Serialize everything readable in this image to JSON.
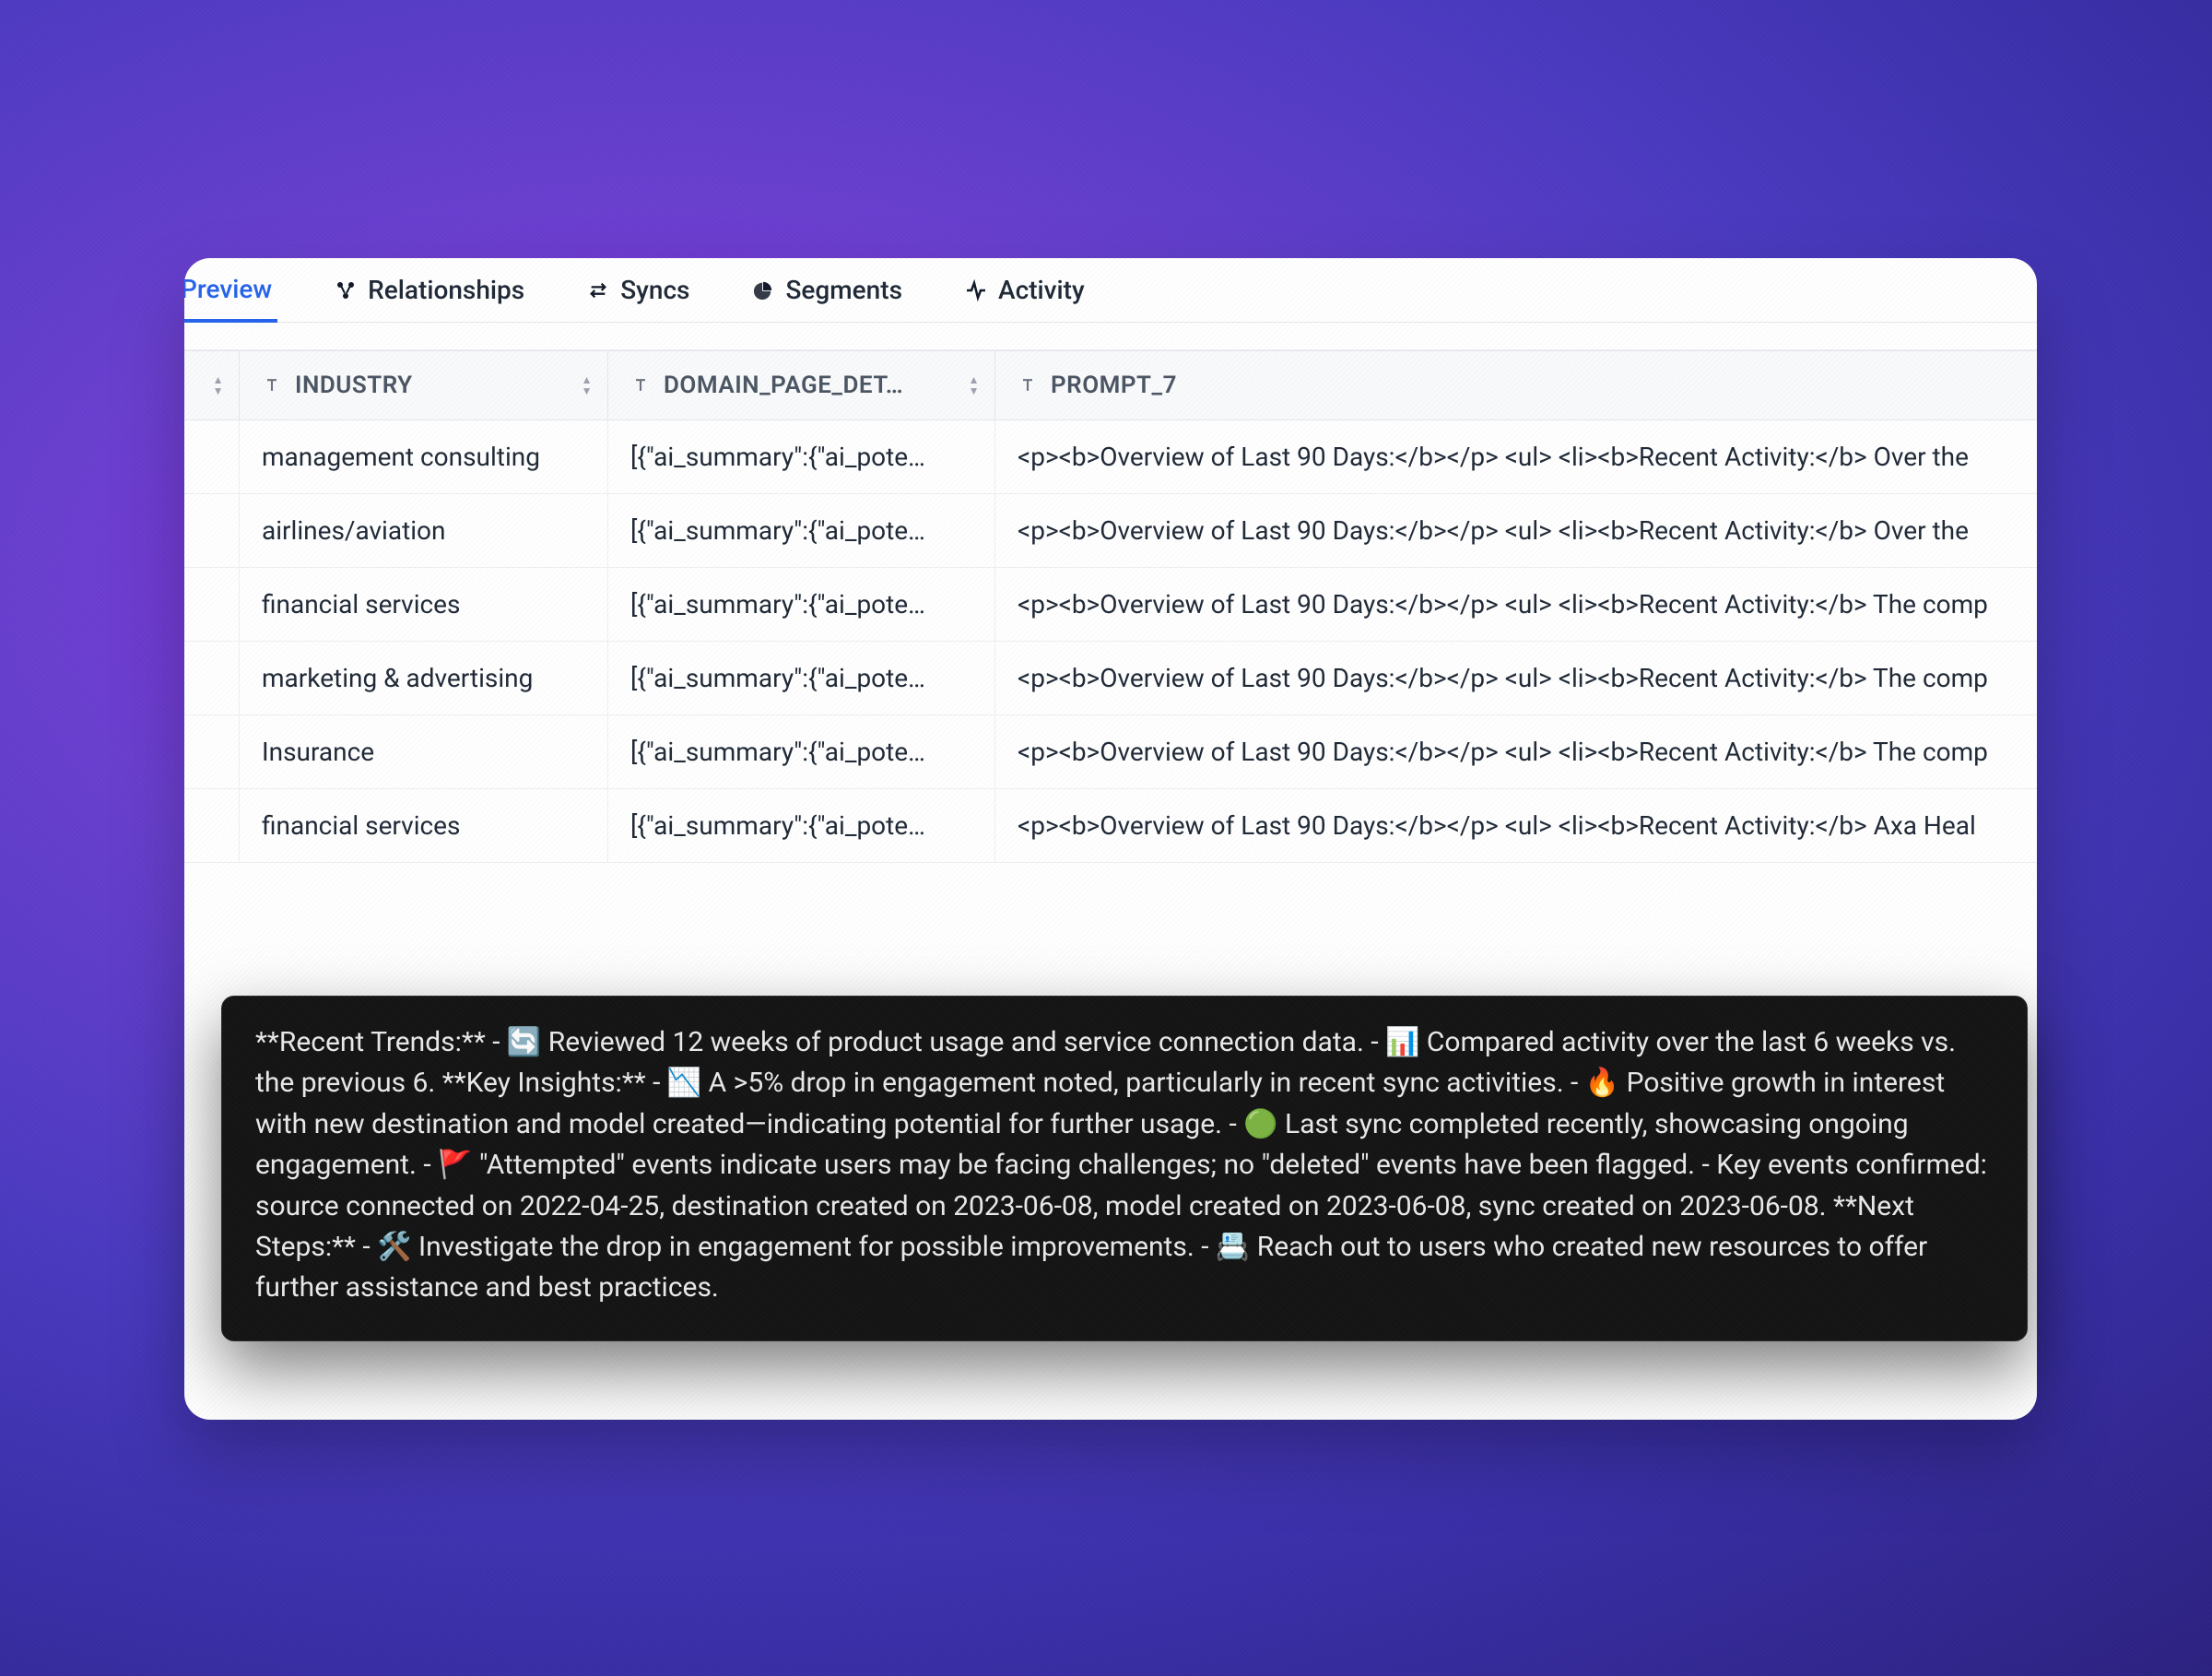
{
  "tabs": [
    {
      "id": "preview",
      "label": "Preview",
      "icon": "none",
      "active": true
    },
    {
      "id": "relationships",
      "label": "Relationships",
      "icon": "relationships",
      "active": false
    },
    {
      "id": "syncs",
      "label": "Syncs",
      "icon": "syncs",
      "active": false
    },
    {
      "id": "segments",
      "label": "Segments",
      "icon": "segments",
      "active": false
    },
    {
      "id": "activity",
      "label": "Activity",
      "icon": "activity",
      "active": false
    }
  ],
  "columns": {
    "industry": "INDUSTRY",
    "domain": "DOMAIN_PAGE_DET…",
    "prompt7": "PROMPT_7"
  },
  "rows": [
    {
      "industry": "management consulting",
      "domain": "[{\"ai_summary\":{\"ai_pote…",
      "prompt7": "<p><b>Overview of Last 90 Days:</b></p> <ul> <li><b>Recent Activity:</b> Over the"
    },
    {
      "industry": "airlines/aviation",
      "domain": "[{\"ai_summary\":{\"ai_pote…",
      "prompt7": "<p><b>Overview of Last 90 Days:</b></p> <ul> <li><b>Recent Activity:</b> Over the"
    },
    {
      "industry": "financial services",
      "domain": "[{\"ai_summary\":{\"ai_pote…",
      "prompt7": "<p><b>Overview of Last 90 Days:</b></p> <ul> <li><b>Recent Activity:</b> The comp"
    },
    {
      "industry": "marketing & advertising",
      "domain": "[{\"ai_summary\":{\"ai_pote…",
      "prompt7": "<p><b>Overview of Last 90 Days:</b></p> <ul> <li><b>Recent Activity:</b> The comp"
    },
    {
      "industry": "Insurance",
      "domain": "[{\"ai_summary\":{\"ai_pote…",
      "prompt7": "<p><b>Overview of Last 90 Days:</b></p> <ul> <li><b>Recent Activity:</b> The comp"
    },
    {
      "industry": "financial services",
      "domain": "[{\"ai_summary\":{\"ai_pote…",
      "prompt7": "<p><b>Overview of Last 90 Days:</b></p> <ul> <li><b>Recent Activity:</b> Axa Heal"
    }
  ],
  "tooltip_text": "**Recent Trends:**  - 🔄 Reviewed 12 weeks of product usage and service connection data. - 📊 Compared activity over the last 6 weeks vs. the previous 6.  **Key Insights:**  - 📉 A >5% drop in engagement noted, particularly in recent sync activities. - 🔥 Positive growth in interest with new destination and model created—indicating potential for further usage. - 🟢 Last sync completed recently, showcasing ongoing engagement. - 🚩 \"Attempted\" events indicate users may be facing challenges; no \"deleted\" events have been flagged. - Key events confirmed: source connected on 2022-04-25, destination created on 2023-06-08, model created on 2023-06-08, sync created on 2023-06-08.  **Next Steps:**  - 🛠️ Investigate the drop in engagement for possible improvements. - 📇 Reach out to users who created new resources to offer further assistance and best practices."
}
